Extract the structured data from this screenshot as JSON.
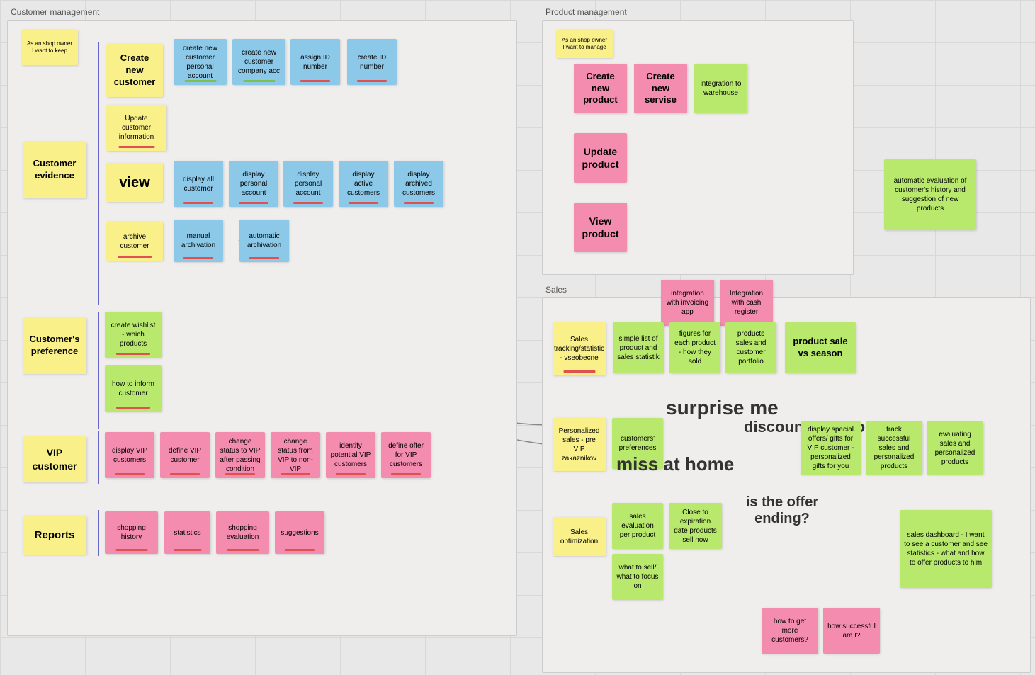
{
  "sections": {
    "customer_management": "Customer management",
    "product_management": "Product management",
    "sales": "Sales"
  },
  "stickies": {
    "owner_note1": "As an shop owner I want to keep",
    "owner_note2": "As an shop owner I want to manage",
    "customer_evidence": "Customer evidence",
    "customers_preference": "Customer's preference",
    "vip_customer": "VIP customer",
    "reports": "Reports",
    "create_new_customer": "Create new customer",
    "create_personal": "create new customer personal account",
    "create_company": "create new customer company acc",
    "assign_id": "assign ID number",
    "create_id": "create ID number",
    "update_customer": "Update customer information",
    "view": "view",
    "display_all": "display all customer",
    "display_personal1": "display personal account",
    "display_personal2": "display personal account",
    "display_active": "display active customers",
    "display_archived": "display archived customers",
    "archive_customer": "archive customer",
    "manual_archivation": "manual archivation",
    "automatic_archivation": "automatic archivation",
    "create_wishlist": "create wishlist - which products",
    "how_to_inform": "how to inform customer",
    "display_vip": "display VIP customers",
    "define_vip": "define VIP customer",
    "change_status_to_vip": "change status to VIP after passing condition",
    "change_status_from_vip": "change status from VIP to non-VIP",
    "identify_potential_vip": "identify potential VIP customers",
    "define_offer_vip": "define offer for VIP customers",
    "shopping_history": "shopping history",
    "statistics": "statistics",
    "shopping_evaluation": "shopping evaluation",
    "suggestions": "suggestions",
    "create_new_product": "Create new product",
    "create_new_service": "Create new servise",
    "integration_warehouse": "integration to warehouse",
    "update_product": "Update product",
    "view_product": "View product",
    "auto_evaluation": "automatic evaluation of customer's history and suggestion of new products",
    "sales_tracking": "Sales tracking/statistic - vseobecne",
    "simple_list": "simple list of product and sales statistik",
    "figures_product": "figures for each product - how they sold",
    "products_sales": "products sales and customer portfolio",
    "product_sale_season": "product sale vs season",
    "integration_invoicing": "integration with invoicing app",
    "integration_cash": "Integration with cash register",
    "surprise_me": "surprise me",
    "personalized_sales": "Personalized sales - pre VIP zakaznikov",
    "customers_preferences": "customers' preferences",
    "discounts_for_you": "discounts for you",
    "miss_at_home": "miss at home",
    "display_special": "display special offers/ gifts for VIP customer - personalized gifts for you",
    "track_successful": "track successful sales and personalized products",
    "evaluating_sales": "evaluating sales and personalized products",
    "sales_evaluation_product": "sales evaluation per product",
    "close_to_expiration": "Close to expiration date products sell now",
    "what_to_sell": "what to sell/ what to focus on",
    "is_offer_ending": "is the offer ending?",
    "sales_optimization": "Sales optimization",
    "sales_dashboard": "sales dashboard - I want to see a customer and see statistics - what and how to offer products to him",
    "how_to_get_customers": "how to get more customers?",
    "how_successful": "how successful am I?"
  }
}
